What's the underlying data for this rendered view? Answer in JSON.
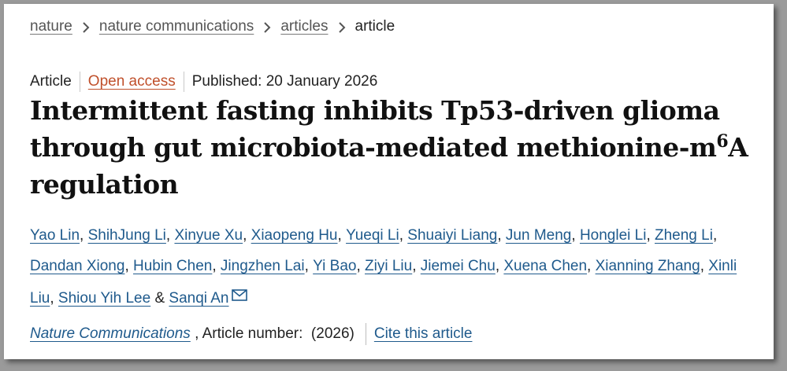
{
  "breadcrumb": {
    "items": [
      "nature",
      "nature communications",
      "articles"
    ],
    "current": "article"
  },
  "meta": {
    "type": "Article",
    "access": "Open access",
    "published": "Published: 20 January 2026"
  },
  "title": {
    "main": "Intermittent fasting inhibits Tp53-driven glioma through gut microbiota-mediated methionine-m",
    "superscript": "6",
    "tail": "A regulation"
  },
  "authors": [
    "Yao Lin",
    "ShihJung Li",
    "Xinyue Xu",
    "Xiaopeng Hu",
    "Yueqi Li",
    "Shuaiyi Liang",
    "Jun Meng",
    "Honglei Li",
    "Zheng Li",
    "Dandan Xiong",
    "Hubin Chen",
    "Jingzhen Lai",
    "Yi Bao",
    "Ziyi Liu",
    "Jiemei Chu",
    "Xuena Chen",
    "Xianning Zhang",
    "Xinli Liu",
    "Shiou Yih Lee",
    "Sanqi An"
  ],
  "authors_separator": ", ",
  "authors_last_separator": " & ",
  "citation": {
    "journal": "Nature Communications",
    "article_number_text": " , Article number:  (2026)",
    "cite_label": "Cite this article"
  },
  "colors": {
    "link": "#1f5a8c",
    "open_access": "#c0502b"
  },
  "icons": {
    "breadcrumb_separator": "chevron-right-icon",
    "corresponding_author": "mail-icon"
  }
}
